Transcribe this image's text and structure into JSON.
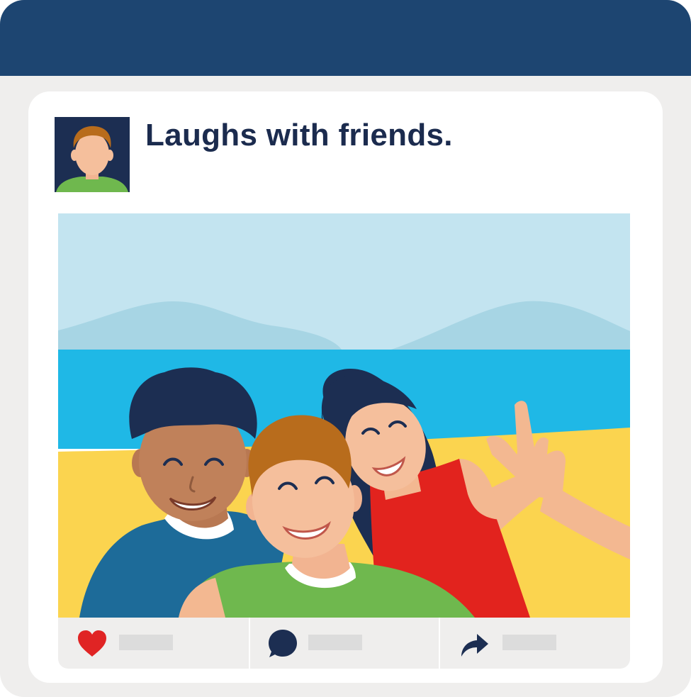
{
  "post": {
    "caption": "Laughs with friends."
  },
  "actions": {
    "like": {
      "icon": "heart-icon",
      "count": ""
    },
    "comment": {
      "icon": "speech-bubble-icon",
      "count": ""
    },
    "share": {
      "icon": "share-arrow-icon",
      "count": ""
    }
  },
  "colors": {
    "titlebar": "#1d4571",
    "window": "#efeeed",
    "card": "#ffffff",
    "text": "#1b2b4e",
    "heart": "#e02424",
    "sky": "#c3e4f0",
    "sea": "#1fb8e6",
    "sand": "#fbd44f"
  }
}
